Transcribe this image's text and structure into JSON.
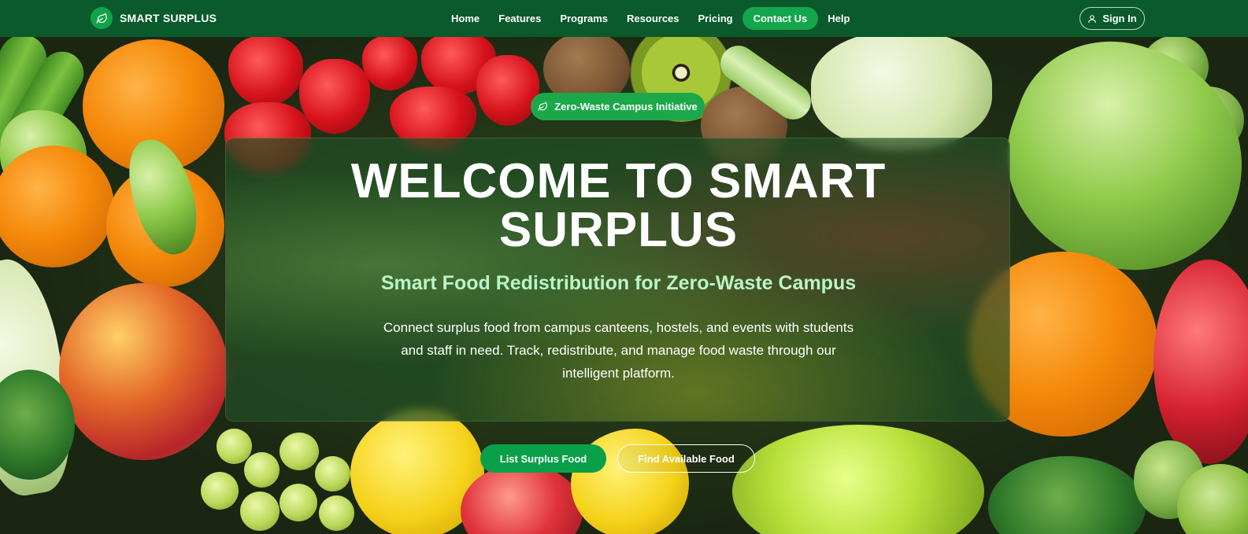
{
  "brand": {
    "name": "SMART SURPLUS",
    "logo_icon": "leaf-icon",
    "logo_color": "#13a24a"
  },
  "nav": {
    "items": [
      {
        "label": "Home",
        "active": false
      },
      {
        "label": "Features",
        "active": false
      },
      {
        "label": "Programs",
        "active": false
      },
      {
        "label": "Resources",
        "active": false
      },
      {
        "label": "Pricing",
        "active": false
      },
      {
        "label": "Contact Us",
        "active": true
      },
      {
        "label": "Help",
        "active": false
      }
    ],
    "signin_label": "Sign In",
    "signin_icon": "user-icon",
    "bar_color": "#0a5a2c",
    "active_color": "#14a64c"
  },
  "hero": {
    "badge_label": "Zero-Waste Campus Initiative",
    "badge_icon": "leaf-icon",
    "title_line1": "WELCOME TO SMART",
    "title_line2": "SURPLUS",
    "subtitle": "Smart Food Redistribution for Zero-Waste Campus",
    "desc_line1": "Connect surplus food from campus canteens, hostels, and events with students",
    "desc_line2": "and staff in need. Track, redistribute, and manage food waste through our",
    "desc_line3": "intelligent platform.",
    "primary_button": "List Surplus Food",
    "secondary_button": "Find Available Food",
    "subtitle_color": "#b9f5c7",
    "primary_color": "#0aa04a"
  }
}
